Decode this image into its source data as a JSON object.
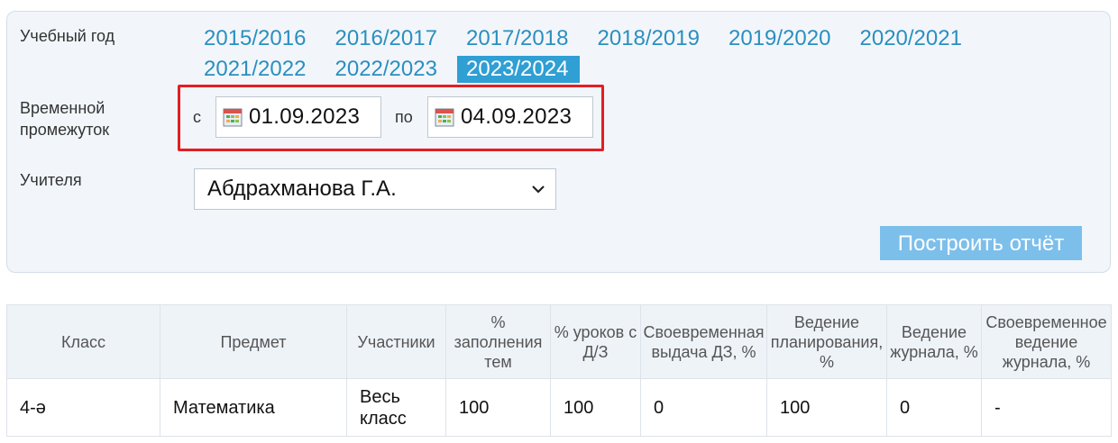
{
  "filters": {
    "year_label": "Учебный год",
    "years_row1": [
      "2015/2016",
      "2016/2017",
      "2017/2018",
      "2018/2019",
      "2019/2020",
      "2020/2021"
    ],
    "years_row2": [
      "2021/2022",
      "2022/2023",
      "2023/2024"
    ],
    "active_year": "2023/2024",
    "period_label": "Временной промежуток",
    "from_prep": "с",
    "from_date": "01.09.2023",
    "to_prep": "по",
    "to_date": "04.09.2023",
    "teacher_label": "Учителя",
    "teacher_value": "Абдрахманова Г.А.",
    "build_button": "Построить отчёт"
  },
  "table": {
    "headers": [
      "Класс",
      "Предмет",
      "Участники",
      "% заполнения тем",
      "% уроков с Д/З",
      "Своевременная выдача ДЗ, %",
      "Ведение планирования, %",
      "Ведение журнала, %",
      "Своевременное ведение журнала, %"
    ],
    "rows": [
      [
        "4-ә",
        "Математика",
        "Весь класс",
        "100",
        "100",
        "0",
        "100",
        "0",
        "-"
      ]
    ]
  },
  "colors": {
    "link": "#2a8fbf",
    "active_year_bg": "#2f9fd4",
    "highlight": "#e31e24",
    "button_bg": "#7dbfeb"
  },
  "icons": {
    "date": "calendar-icon",
    "select": "chevron-down-icon"
  }
}
